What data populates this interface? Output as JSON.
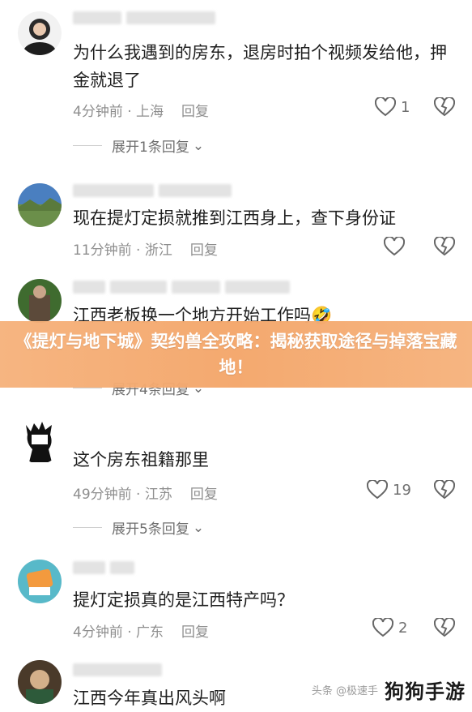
{
  "comments": [
    {
      "text": "为什么我遇到的房东，退房时拍个视频发给他，押金就退了",
      "location": "4分钟前 · 上海",
      "reply": "回复",
      "likes": "1",
      "expand": "展开1条回复"
    },
    {
      "text": "现在提灯定损就推到江西身上，查下身份证",
      "location": "11分钟前 · 浙江",
      "reply": "回复",
      "likes": ""
    },
    {
      "text": "江西老板换一个地方开始工作吗🤣",
      "location": "",
      "reply": "",
      "likes": "",
      "expand": "展开4条回复"
    },
    {
      "text": "这个房东祖籍那里",
      "location": "49分钟前 · 江苏",
      "reply": "回复",
      "likes": "19",
      "expand": "展开5条回复"
    },
    {
      "text": "提灯定损真的是江西特产吗？",
      "location": "4分钟前 · 广东",
      "reply": "回复",
      "likes": "2"
    },
    {
      "text": "江西今年真出风头啊"
    }
  ],
  "banner": {
    "title": "《提灯与地下城》契约兽全攻略：揭秘获取途径与掉落宝藏地！"
  },
  "watermark": {
    "small": "头条 @极速手",
    "brand": "狗狗手游"
  },
  "colors": {
    "banner": "#f4a66a",
    "meta": "#8e8e8e"
  }
}
